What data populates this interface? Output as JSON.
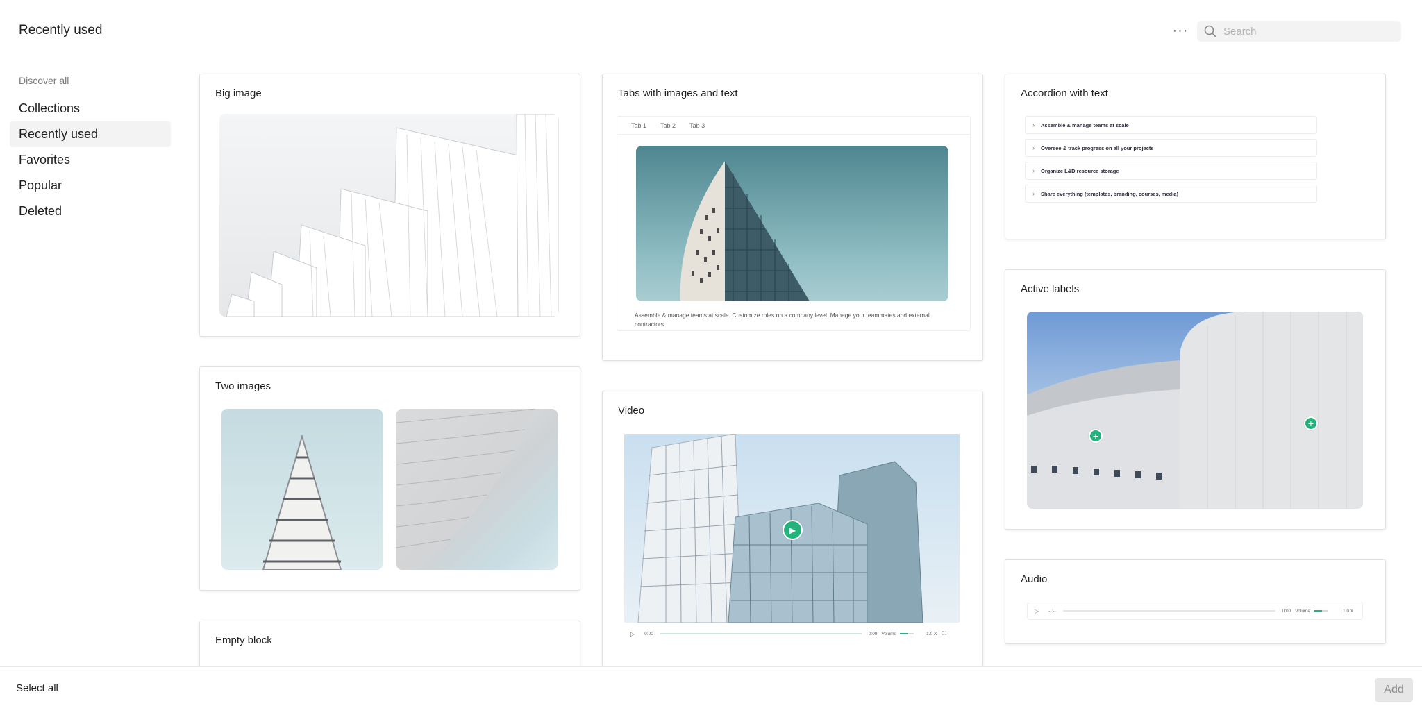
{
  "header": {
    "title": "Recently used",
    "more_label": "···",
    "search_placeholder": "Search"
  },
  "sidebar": {
    "heading": "Discover all",
    "items": [
      {
        "label": "Collections"
      },
      {
        "label": "Recently used",
        "active": true
      },
      {
        "label": "Favorites"
      },
      {
        "label": "Popular"
      },
      {
        "label": "Deleted"
      }
    ]
  },
  "cards": {
    "big_image": {
      "title": "Big image"
    },
    "two_images": {
      "title": "Two images"
    },
    "empty_block": {
      "title": "Empty block"
    },
    "tabs": {
      "title": "Tabs with images and text",
      "tab_labels": [
        "Tab 1",
        "Tab 2",
        "Tab 3"
      ],
      "text": "Assemble & manage teams at scale. Customize roles on a company level. Manage your teammates and external contractors."
    },
    "video": {
      "title": "Video",
      "time_current": "0:00",
      "time_total": "0:09",
      "volume_label": "Volume",
      "volume_level": 0.6,
      "speed": "1.0 X"
    },
    "accordion": {
      "title": "Accordion with text",
      "items": [
        "Assemble & manage teams at scale",
        "Oversee & track progress on all your projects",
        "Organize L&D resource storage",
        "Share everything (templates, branding, courses, media)"
      ]
    },
    "active_labels": {
      "title": "Active labels"
    },
    "audio": {
      "title": "Audio",
      "time_current": "--:--",
      "time_total": "0:00",
      "volume_label": "Volume",
      "volume_level": 0.6,
      "speed": "1.0 X"
    }
  },
  "footer": {
    "select_all": "Select all",
    "add_label": "Add"
  },
  "colors": {
    "accent": "#23b27c",
    "sidebar_active": "#f3f3f4"
  }
}
